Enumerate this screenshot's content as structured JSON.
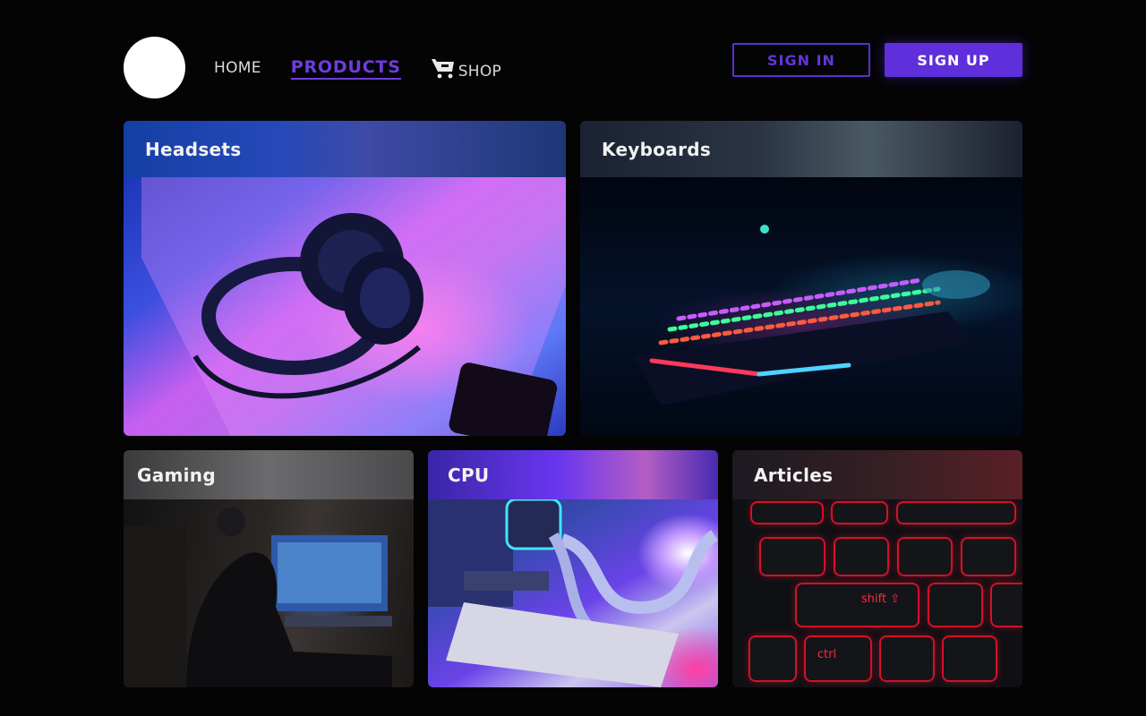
{
  "header": {
    "nav": {
      "home": "HOME",
      "products": "PRODUCTS",
      "shop": "SHOP"
    },
    "sign_in": "SIGN IN",
    "sign_up": "SIGN UP"
  },
  "cards": {
    "headsets": "Headsets",
    "keyboards": "Keyboards",
    "gaming": "Gaming",
    "cpu": "CPU",
    "articles": "Articles"
  },
  "image_text": {
    "article_keys": [
      "shift ⇧",
      "ctrl"
    ]
  },
  "colors": {
    "accent": "#5f2fdb",
    "background": "#040405"
  },
  "icons": {
    "cart": "cart-icon"
  }
}
